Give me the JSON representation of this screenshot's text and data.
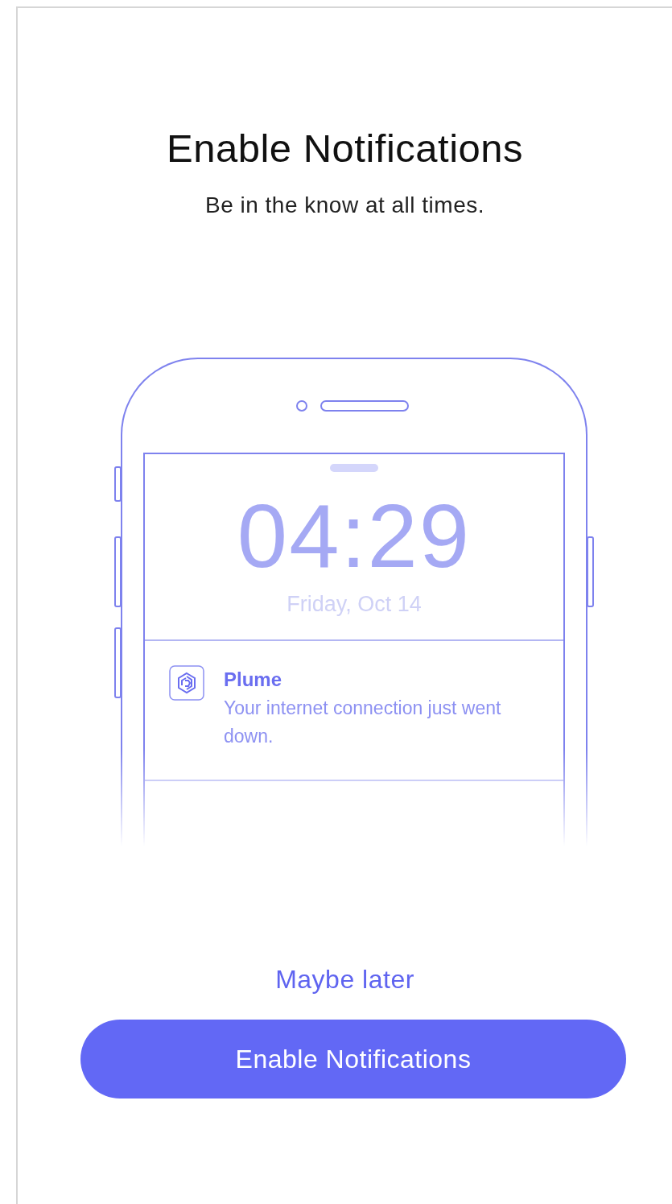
{
  "title": "Enable Notifications",
  "subtitle": "Be in the know at all times.",
  "phone": {
    "clock": "04:29",
    "date": "Friday, Oct 14",
    "notification": {
      "app": "Plume",
      "message": "Your internet connection just went down."
    }
  },
  "secondary_button": "Maybe later",
  "primary_button": "Enable Notifications"
}
